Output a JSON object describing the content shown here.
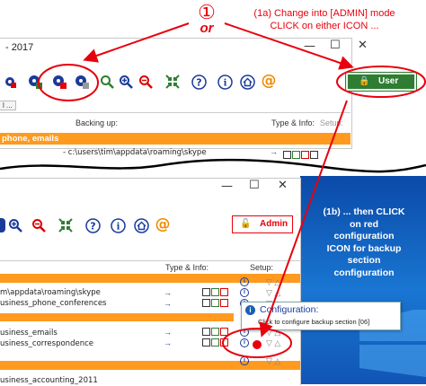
{
  "top_window": {
    "title": "- 2017",
    "user_button_label": "User",
    "col_backing_up": "Backing up:",
    "col_type_info": "Type & Info:",
    "col_setup": "Setup:",
    "section_header": "phone, emails",
    "path_row": "- c:\\users\\tim\\appdata\\roaming\\skype",
    "tab_fragment": "l ..."
  },
  "bottom_window": {
    "admin_button_label": "Admin",
    "col_type_info": "Type & Info:",
    "col_setup": "Setup:",
    "rows": [
      "m\\appdata\\roaming\\skype",
      "usiness_phone_conferences",
      "usiness_emails",
      "usiness_correspondence",
      "usiness_accounting_2011"
    ]
  },
  "annotations": {
    "circled_number": "①",
    "or": "or",
    "step_1a_line1": "(1a) Change into [ADMIN] mode",
    "step_1a_line2": "CLICK on either ICON ...",
    "step_1b_lines": [
      "(1b) ... then CLICK",
      "on red",
      "configuration",
      "ICON for backup",
      "section",
      "configuration"
    ]
  },
  "tooltip": {
    "title": "Configuration:",
    "text": "Click to configure backup section [06]"
  },
  "colors": {
    "accent_red": "#e8000c",
    "orange_band": "#ff9a1f",
    "desktop_blue": "#1565c0",
    "user_green": "#2e7d32"
  }
}
